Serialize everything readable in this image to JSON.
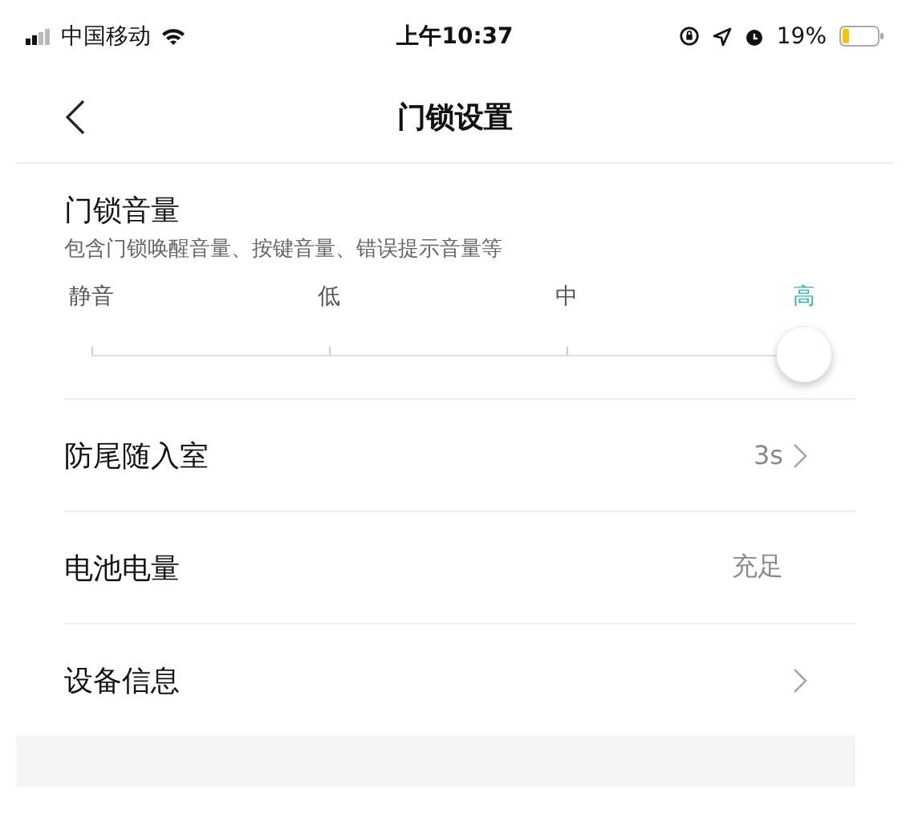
{
  "status_bar": {
    "carrier": "中国移动",
    "time": "上午10:37",
    "battery": "19%"
  },
  "nav": {
    "title": "门锁设置"
  },
  "volume": {
    "title": "门锁音量",
    "description": "包含门锁唤醒音量、按键音量、错误提示音量等",
    "level": 1,
    "options": [
      {
        "label": "静音",
        "selected": false
      },
      {
        "label": "低",
        "selected": false
      },
      {
        "label": "中",
        "selected": false
      },
      {
        "label": "高",
        "selected": true
      }
    ]
  },
  "rows": [
    {
      "label": "防尾随入室",
      "value": "3s",
      "chevron": true
    },
    {
      "label": "电池电量",
      "value": "充足",
      "chevron": false
    },
    {
      "label": "设备信息",
      "chevron": true
    }
  ]
}
